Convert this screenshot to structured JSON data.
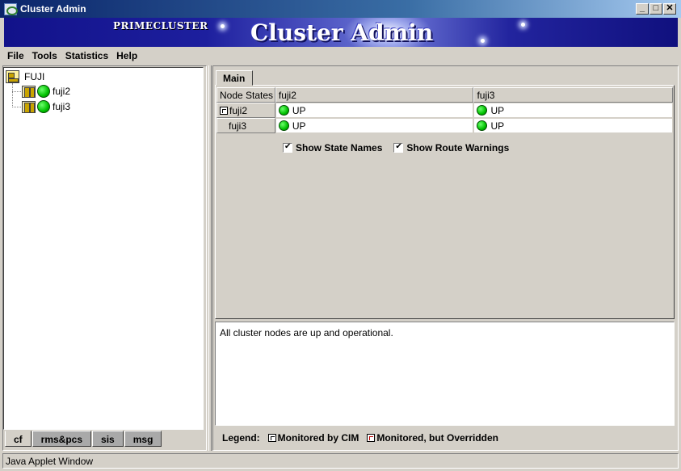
{
  "window": {
    "title": "Cluster Admin",
    "buttons": {
      "minimize": "_",
      "maximize": "□",
      "close": "✕"
    }
  },
  "banner": {
    "brand": "PRIMECLUSTER",
    "title": "Cluster Admin"
  },
  "menubar": {
    "items": [
      "File",
      "Tools",
      "Statistics",
      "Help"
    ]
  },
  "tree": {
    "root": {
      "label": "FUJI",
      "icon": "cluster-icon"
    },
    "nodes": [
      {
        "label": "fuji2",
        "icon": "node-icon",
        "status_color": "#00c000"
      },
      {
        "label": "fuji3",
        "icon": "node-icon",
        "status_color": "#00c000"
      }
    ]
  },
  "bottom_tabs": [
    "cf",
    "rms&pcs",
    "sis",
    "msg"
  ],
  "main": {
    "tab_label": "Main",
    "grid": {
      "corner_header": "Node States",
      "columns": [
        "fuji2",
        "fuji3"
      ],
      "rows": [
        {
          "label": "fuji2",
          "marker": "cim-mark",
          "cells": [
            "UP",
            "UP"
          ]
        },
        {
          "label": "fuji3",
          "marker": "",
          "cells": [
            "UP",
            "UP"
          ]
        }
      ]
    },
    "checkboxes": [
      {
        "label": "Show State Names",
        "checked": true
      },
      {
        "label": "Show Route Warnings",
        "checked": true
      }
    ],
    "message": "All cluster nodes are up and operational."
  },
  "legend": {
    "title": "Legend:",
    "items": [
      "Monitored by CIM",
      "Monitored, but Overridden"
    ]
  },
  "status": {
    "text": "Java Applet Window"
  }
}
